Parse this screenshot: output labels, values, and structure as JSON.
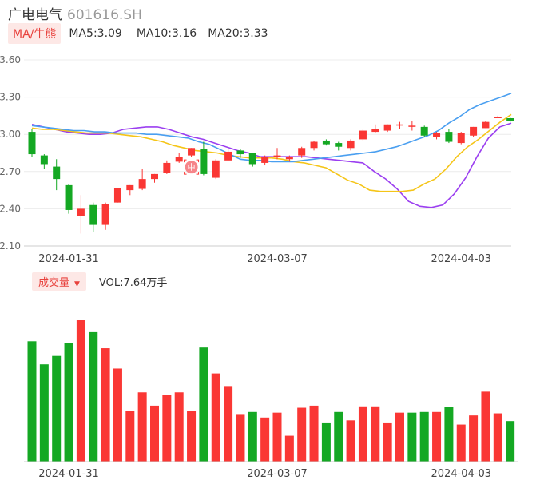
{
  "header": {
    "name": "广电电气",
    "code": "601616.SH"
  },
  "ma_legend": {
    "toggle": "MA/牛熊",
    "ma5": "MA5:3.09",
    "ma10": "MA10:3.16",
    "ma20": "MA20:3.33"
  },
  "volume_legend": {
    "toggle": "成交量",
    "value": "VOL:7.64万手"
  },
  "colors": {
    "up": "#fa3734",
    "down": "#14a823",
    "ma5": "#9b3ff0",
    "ma10": "#f5c518",
    "ma20": "#4a9ff0",
    "accent": "#e8413c"
  },
  "marker": {
    "label": "中",
    "index": 13
  },
  "chart_data": [
    {
      "type": "candlestick",
      "ylim": [
        2.1,
        3.6
      ],
      "yticks": [
        "3.60",
        "3.30",
        "3.00",
        "2.70",
        "2.40",
        "2.10"
      ],
      "xticks": [
        {
          "index": 3,
          "label": "2024-01-31"
        },
        {
          "index": 20,
          "label": "2024-03-07"
        },
        {
          "index": 35,
          "label": "2024-04-03"
        }
      ],
      "candles": [
        {
          "o": 3.02,
          "c": 2.84,
          "h": 3.04,
          "l": 2.82
        },
        {
          "o": 2.83,
          "c": 2.76,
          "h": 2.84,
          "l": 2.72
        },
        {
          "o": 2.74,
          "c": 2.64,
          "h": 2.8,
          "l": 2.55
        },
        {
          "o": 2.59,
          "c": 2.39,
          "h": 2.6,
          "l": 2.36
        },
        {
          "o": 2.34,
          "c": 2.4,
          "h": 2.51,
          "l": 2.2
        },
        {
          "o": 2.43,
          "c": 2.27,
          "h": 2.45,
          "l": 2.21
        },
        {
          "o": 2.27,
          "c": 2.44,
          "h": 2.45,
          "l": 2.23
        },
        {
          "o": 2.45,
          "c": 2.57,
          "h": 2.57,
          "l": 2.45
        },
        {
          "o": 2.55,
          "c": 2.59,
          "h": 2.59,
          "l": 2.51
        },
        {
          "o": 2.56,
          "c": 2.64,
          "h": 2.72,
          "l": 2.55
        },
        {
          "o": 2.64,
          "c": 2.68,
          "h": 2.68,
          "l": 2.61
        },
        {
          "o": 2.69,
          "c": 2.77,
          "h": 2.79,
          "l": 2.68
        },
        {
          "o": 2.78,
          "c": 2.82,
          "h": 2.85,
          "l": 2.77
        },
        {
          "o": 2.83,
          "c": 2.89,
          "h": 2.89,
          "l": 2.82
        },
        {
          "o": 2.88,
          "c": 2.68,
          "h": 2.94,
          "l": 2.67
        },
        {
          "o": 2.65,
          "c": 2.79,
          "h": 2.8,
          "l": 2.64
        },
        {
          "o": 2.79,
          "c": 2.86,
          "h": 2.88,
          "l": 2.79
        },
        {
          "o": 2.87,
          "c": 2.84,
          "h": 2.88,
          "l": 2.81
        },
        {
          "o": 2.85,
          "c": 2.76,
          "h": 2.85,
          "l": 2.74
        },
        {
          "o": 2.77,
          "c": 2.82,
          "h": 2.83,
          "l": 2.75
        },
        {
          "o": 2.83,
          "c": 2.83,
          "h": 2.89,
          "l": 2.8
        },
        {
          "o": 2.8,
          "c": 2.82,
          "h": 2.83,
          "l": 2.78
        },
        {
          "o": 2.83,
          "c": 2.89,
          "h": 2.9,
          "l": 2.81
        },
        {
          "o": 2.89,
          "c": 2.94,
          "h": 2.95,
          "l": 2.87
        },
        {
          "o": 2.95,
          "c": 2.92,
          "h": 2.96,
          "l": 2.91
        },
        {
          "o": 2.93,
          "c": 2.9,
          "h": 2.94,
          "l": 2.87
        },
        {
          "o": 2.89,
          "c": 2.95,
          "h": 2.96,
          "l": 2.87
        },
        {
          "o": 2.96,
          "c": 3.03,
          "h": 3.04,
          "l": 2.95
        },
        {
          "o": 3.02,
          "c": 3.04,
          "h": 3.08,
          "l": 3.01
        },
        {
          "o": 3.03,
          "c": 3.08,
          "h": 3.08,
          "l": 3.02
        },
        {
          "o": 3.08,
          "c": 3.08,
          "h": 3.1,
          "l": 3.04
        },
        {
          "o": 3.07,
          "c": 3.07,
          "h": 3.11,
          "l": 3.03
        },
        {
          "o": 3.06,
          "c": 2.99,
          "h": 3.07,
          "l": 2.98
        },
        {
          "o": 2.98,
          "c": 3.01,
          "h": 3.02,
          "l": 2.96
        },
        {
          "o": 3.02,
          "c": 2.94,
          "h": 3.04,
          "l": 2.93
        },
        {
          "o": 2.93,
          "c": 3.01,
          "h": 3.02,
          "l": 2.92
        },
        {
          "o": 2.99,
          "c": 3.06,
          "h": 3.06,
          "l": 2.98
        },
        {
          "o": 3.05,
          "c": 3.1,
          "h": 3.11,
          "l": 3.05
        },
        {
          "o": 3.13,
          "c": 3.14,
          "h": 3.15,
          "l": 3.13
        },
        {
          "o": 3.13,
          "c": 3.11,
          "h": 3.14,
          "l": 3.1
        }
      ],
      "series": [
        {
          "name": "MA5",
          "values": [
            3.08,
            3.06,
            3.04,
            3.02,
            3.01,
            3.0,
            3.0,
            3.01,
            3.04,
            3.05,
            3.06,
            3.06,
            3.04,
            3.01,
            2.98,
            2.96,
            2.93,
            2.9,
            2.87,
            2.85,
            2.82,
            2.82,
            2.82,
            2.82,
            2.82,
            2.81,
            2.8,
            2.79,
            2.78,
            2.77,
            2.7,
            2.64,
            2.56,
            2.46,
            2.42,
            2.41,
            2.43,
            2.52,
            2.65,
            2.82,
            2.97,
            3.06,
            3.09
          ]
        },
        {
          "name": "MA10",
          "values": [
            3.05,
            3.04,
            3.04,
            3.03,
            3.02,
            3.01,
            3.01,
            3.01,
            3.0,
            2.99,
            2.98,
            2.96,
            2.94,
            2.91,
            2.89,
            2.87,
            2.86,
            2.85,
            2.83,
            2.82,
            2.81,
            2.81,
            2.81,
            2.8,
            2.78,
            2.77,
            2.75,
            2.73,
            2.68,
            2.63,
            2.6,
            2.55,
            2.54,
            2.54,
            2.54,
            2.55,
            2.6,
            2.64,
            2.72,
            2.82,
            2.9,
            2.96,
            3.03,
            3.1,
            3.16
          ]
        },
        {
          "name": "MA20",
          "values": [
            3.07,
            3.06,
            3.05,
            3.04,
            3.03,
            3.03,
            3.02,
            3.02,
            3.01,
            3.01,
            3.01,
            3.0,
            3.0,
            2.99,
            2.98,
            2.97,
            2.94,
            2.92,
            2.88,
            2.84,
            2.8,
            2.79,
            2.79,
            2.78,
            2.78,
            2.78,
            2.79,
            2.8,
            2.81,
            2.82,
            2.83,
            2.84,
            2.85,
            2.86,
            2.88,
            2.9,
            2.93,
            2.96,
            2.99,
            3.03,
            3.09,
            3.14,
            3.2,
            3.24,
            3.27,
            3.3,
            3.33
          ]
        }
      ]
    },
    {
      "type": "bar",
      "title": "成交量",
      "values": [
        {
          "v": 172,
          "d": "down"
        },
        {
          "v": 139,
          "d": "down"
        },
        {
          "v": 151,
          "d": "down"
        },
        {
          "v": 169,
          "d": "down"
        },
        {
          "v": 202,
          "d": "up"
        },
        {
          "v": 185,
          "d": "down"
        },
        {
          "v": 162,
          "d": "up"
        },
        {
          "v": 133,
          "d": "up"
        },
        {
          "v": 72,
          "d": "up"
        },
        {
          "v": 99,
          "d": "up"
        },
        {
          "v": 80,
          "d": "up"
        },
        {
          "v": 95,
          "d": "up"
        },
        {
          "v": 99,
          "d": "up"
        },
        {
          "v": 72,
          "d": "up"
        },
        {
          "v": 163,
          "d": "down"
        },
        {
          "v": 126,
          "d": "up"
        },
        {
          "v": 108,
          "d": "up"
        },
        {
          "v": 68,
          "d": "up"
        },
        {
          "v": 71,
          "d": "down"
        },
        {
          "v": 63,
          "d": "up"
        },
        {
          "v": 70,
          "d": "up"
        },
        {
          "v": 37,
          "d": "up"
        },
        {
          "v": 77,
          "d": "up"
        },
        {
          "v": 80,
          "d": "up"
        },
        {
          "v": 56,
          "d": "down"
        },
        {
          "v": 71,
          "d": "down"
        },
        {
          "v": 59,
          "d": "up"
        },
        {
          "v": 79,
          "d": "up"
        },
        {
          "v": 79,
          "d": "up"
        },
        {
          "v": 56,
          "d": "up"
        },
        {
          "v": 70,
          "d": "up"
        },
        {
          "v": 70,
          "d": "down"
        },
        {
          "v": 71,
          "d": "down"
        },
        {
          "v": 71,
          "d": "up"
        },
        {
          "v": 78,
          "d": "down"
        },
        {
          "v": 53,
          "d": "up"
        },
        {
          "v": 66,
          "d": "up"
        },
        {
          "v": 100,
          "d": "up"
        },
        {
          "v": 69,
          "d": "up"
        },
        {
          "v": 58,
          "d": "down"
        }
      ],
      "ymax": 210,
      "xticks": [
        {
          "index": 3,
          "label": "2024-01-31"
        },
        {
          "index": 20,
          "label": "2024-03-07"
        },
        {
          "index": 35,
          "label": "2024-04-03"
        }
      ]
    }
  ]
}
